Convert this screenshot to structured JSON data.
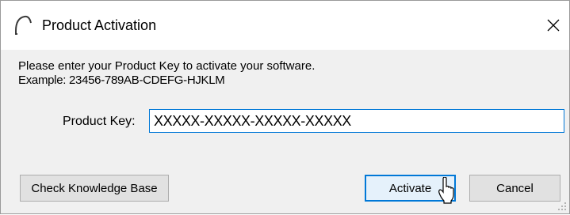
{
  "window": {
    "title": "Product Activation",
    "app_icon": "arc-logo-icon",
    "close_icon": "close-icon"
  },
  "message": {
    "line1": "Please enter your Product Key to activate your software.",
    "line2": "Example: 23456-789AB-CDEFG-HJKLM"
  },
  "product_key": {
    "label": "Product Key:",
    "value": "XXXXX-XXXXX-XXXXX-XXXXX"
  },
  "buttons": {
    "knowledge_base": "Check Knowledge Base",
    "activate": "Activate",
    "cancel": "Cancel"
  },
  "colors": {
    "accent": "#0078d7",
    "button_face": "#e1e1e1",
    "dialog_bg": "#f0f0f0"
  }
}
